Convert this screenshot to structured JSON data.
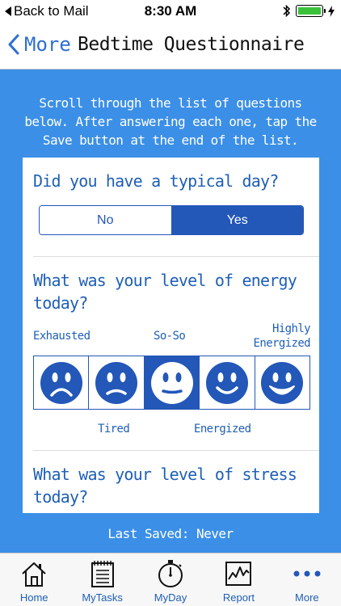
{
  "status_bar": {
    "back_label": "Back to Mail",
    "time": "8:30 AM",
    "bluetooth_icon": "bluetooth-icon",
    "battery_icon": "battery-icon",
    "charging_icon": "charging-bolt-icon"
  },
  "nav": {
    "back_label": "More",
    "title": "Bedtime Questionnaire"
  },
  "intro_text": "Scroll through the list of questions below. After answering each one, tap the Save button at the end of the list.",
  "questions": {
    "typical_day": {
      "text": "Did you have a typical day?",
      "options": [
        "No",
        "Yes"
      ],
      "selected": "Yes"
    },
    "energy": {
      "text": "What was your level of energy today?",
      "top_labels": [
        "Exhausted",
        "So-So",
        "Highly Energized"
      ],
      "bottom_labels": [
        "Tired",
        "Energized"
      ],
      "levels": [
        "Exhausted",
        "Tired",
        "So-So",
        "Energized",
        "Highly Energized"
      ],
      "selected": "So-So"
    },
    "stress": {
      "text": "What was your level of stress today?"
    }
  },
  "last_saved": "Last Saved: Never",
  "tabs": [
    {
      "label": "Home",
      "icon": "house-icon"
    },
    {
      "label": "MyTasks",
      "icon": "notepad-icon"
    },
    {
      "label": "MyDay",
      "icon": "stopwatch-icon"
    },
    {
      "label": "Report",
      "icon": "chart-icon"
    },
    {
      "label": "More",
      "icon": "more-dots-icon"
    }
  ],
  "colors": {
    "background_blue": "#3b8fe6",
    "accent_blue": "#2357b8",
    "text_blue": "#1f5fb6",
    "battery_green": "#3cc13b"
  }
}
